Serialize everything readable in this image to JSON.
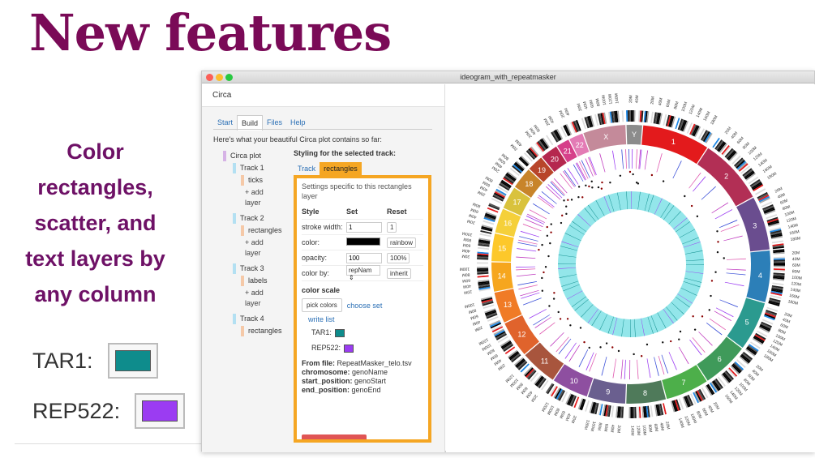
{
  "headline": "New features",
  "feature_text": [
    "Color",
    "rectangles,",
    "scatter, and",
    "text layers by",
    "any column"
  ],
  "legend": [
    {
      "label": "TAR1:",
      "color": "#0e8c8c"
    },
    {
      "label": "REP522:",
      "color": "#9b3cf2"
    }
  ],
  "window": {
    "title": "ideogram_with_repeatmasker"
  },
  "app": {
    "title": "Circa",
    "tabs": [
      "Start",
      "Build",
      "Files",
      "Help"
    ],
    "active_tab": "Build",
    "intro": "Here's what your beautiful Circa plot contains so far:",
    "tree": {
      "root": "Circa plot",
      "tracks": [
        {
          "name": "Track 1",
          "layer": "ticks",
          "add": "+ add layer"
        },
        {
          "name": "Track 2",
          "layer": "rectangles",
          "add": "+ add layer"
        },
        {
          "name": "Track 3",
          "layer": "labels",
          "add": "+ add layer"
        },
        {
          "name": "Track 4",
          "layer": "rectangles"
        }
      ]
    },
    "styling": {
      "title": "Styling for the selected track:",
      "tabs": [
        "Track",
        "rectangles"
      ],
      "settings_note": "Settings specific to this rectangles layer",
      "headers": [
        "Style",
        "Set",
        "Reset"
      ],
      "stroke_width_label": "stroke width:",
      "stroke_width_value": "1",
      "stroke_width_reset": "1",
      "color_label": "color:",
      "color_reset": "rainbow",
      "opacity_label": "opacity:",
      "opacity_value": "100",
      "opacity_reset": "100%",
      "color_by_label": "color by:",
      "color_by_value": "repNam",
      "color_by_reset": "inherit",
      "color_scale_title": "color scale",
      "pick_colors": "pick colors",
      "choose_set": "choose set",
      "write_list": "write list",
      "scale_items": [
        {
          "label": "TAR1:",
          "color": "#0e8c8c"
        },
        {
          "label": "REP522:",
          "color": "#9b3cf2"
        }
      ],
      "from_file_label": "From file:",
      "from_file_value": "RepeatMasker_telo.tsv",
      "chromosome_label": "chromosome:",
      "chromosome_value": "genoName",
      "start_label": "start_position:",
      "start_value": "genoStart",
      "end_label": "end_position:",
      "end_value": "genoEnd"
    }
  },
  "circos": {
    "chromosomes": [
      {
        "label": "1",
        "color": "#e31a1c"
      },
      {
        "label": "2",
        "color": "#b22f55"
      },
      {
        "label": "3",
        "color": "#6a4d8f"
      },
      {
        "label": "4",
        "color": "#2c7fb8"
      },
      {
        "label": "5",
        "color": "#2b9a8f"
      },
      {
        "label": "6",
        "color": "#3f9a5a"
      },
      {
        "label": "7",
        "color": "#4daf4a"
      },
      {
        "label": "8",
        "color": "#4f7a5a"
      },
      {
        "label": "9",
        "color": "#6a5f8f"
      },
      {
        "label": "10",
        "color": "#8e4fa0"
      },
      {
        "label": "11",
        "color": "#a8553d"
      },
      {
        "label": "12",
        "color": "#e0632c"
      },
      {
        "label": "13",
        "color": "#f07b26"
      },
      {
        "label": "14",
        "color": "#f6a61e"
      },
      {
        "label": "15",
        "color": "#fdc82a"
      },
      {
        "label": "16",
        "color": "#f5d03a"
      },
      {
        "label": "17",
        "color": "#d9c23d"
      },
      {
        "label": "18",
        "color": "#c8842a"
      },
      {
        "label": "19",
        "color": "#b8452a"
      },
      {
        "label": "20",
        "color": "#b5274e"
      },
      {
        "label": "21",
        "color": "#d63f8a"
      },
      {
        "label": "22",
        "color": "#e37bb5"
      },
      {
        "label": "X",
        "color": "#c48a9a"
      },
      {
        "label": "Y",
        "color": "#8c8c8c"
      }
    ],
    "inner_ring_color": "#93e6ea",
    "tick_labels": [
      "20M",
      "40M",
      "60M",
      "80M",
      "100M",
      "120M",
      "140M",
      "160M",
      "180M"
    ]
  }
}
